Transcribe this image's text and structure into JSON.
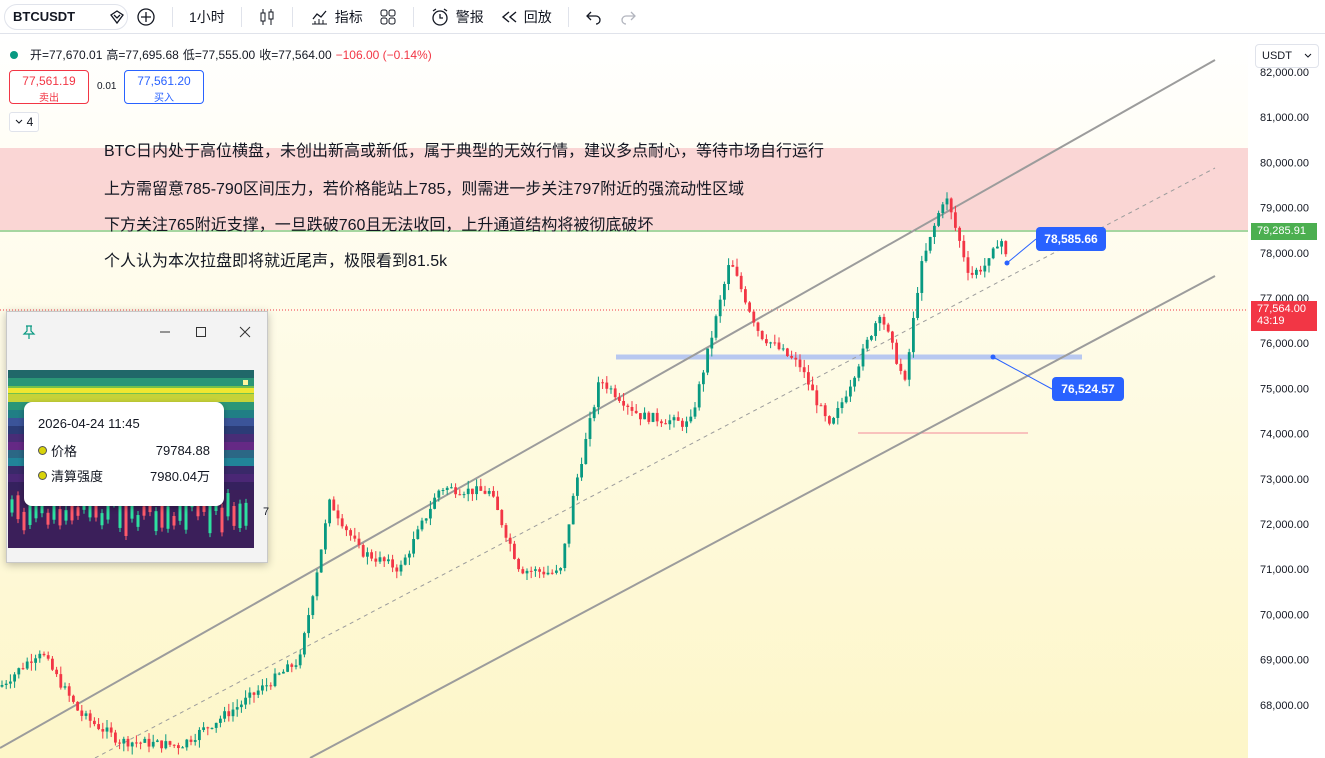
{
  "toolbar": {
    "symbol": "BTCUSDT",
    "interval": "1小时",
    "indicators": "指标",
    "alert": "警报",
    "replay": "回放"
  },
  "ohlc": {
    "open": "开=77,670.01",
    "high": "高=77,695.68",
    "low": "低=77,555.00",
    "close": "收=77,564.00",
    "change": "−106.00 (−0.14%)"
  },
  "trade": {
    "sell_price": "77,561.19",
    "sell_label": "卖出",
    "spread": "0.01",
    "buy_price": "77,561.20",
    "buy_label": "买入"
  },
  "collapse_count": "4",
  "annotations": [
    "BTC日内处于高位横盘，未创出新高或新低，属于典型的无效行情，建议多点耐心，等待市场自行运行",
    "上方需留意785-790区间压力，若价格能站上785，则需进一步关注797附近的强流动性区域",
    "下方关注765附近支撑，一旦跌破760且无法收回，上升通道结构将被彻底破坏",
    "个人认为本次拉盘即将就近尾声，极限看到81.5k"
  ],
  "price_axis": {
    "currency": "USDT",
    "ticks": [
      "82,000.00",
      "81,000.00",
      "80,000.00",
      "79,000.00",
      "78,000.00",
      "77,000.00",
      "76,000.00",
      "75,000.00",
      "74,000.00",
      "73,000.00",
      "72,000.00",
      "71,000.00",
      "70,000.00",
      "69,000.00",
      "68,000.00"
    ],
    "green_label": "79,285.91",
    "current_price": "77,564.00",
    "countdown": "43:19"
  },
  "price_labels": {
    "upper": "78,585.66",
    "lower": "76,524.57"
  },
  "popup": {
    "datetime": "2026-04-24 11:45",
    "rows": [
      {
        "label": "价格",
        "value": "79784.88"
      },
      {
        "label": "清算强度",
        "value": "7980.04万"
      }
    ],
    "edge_char": "7"
  },
  "colors": {
    "up": "#089981",
    "down": "#f23645",
    "accent": "#2962ff",
    "zone": "#f9cfcf",
    "green_label": "#4caf50"
  }
}
